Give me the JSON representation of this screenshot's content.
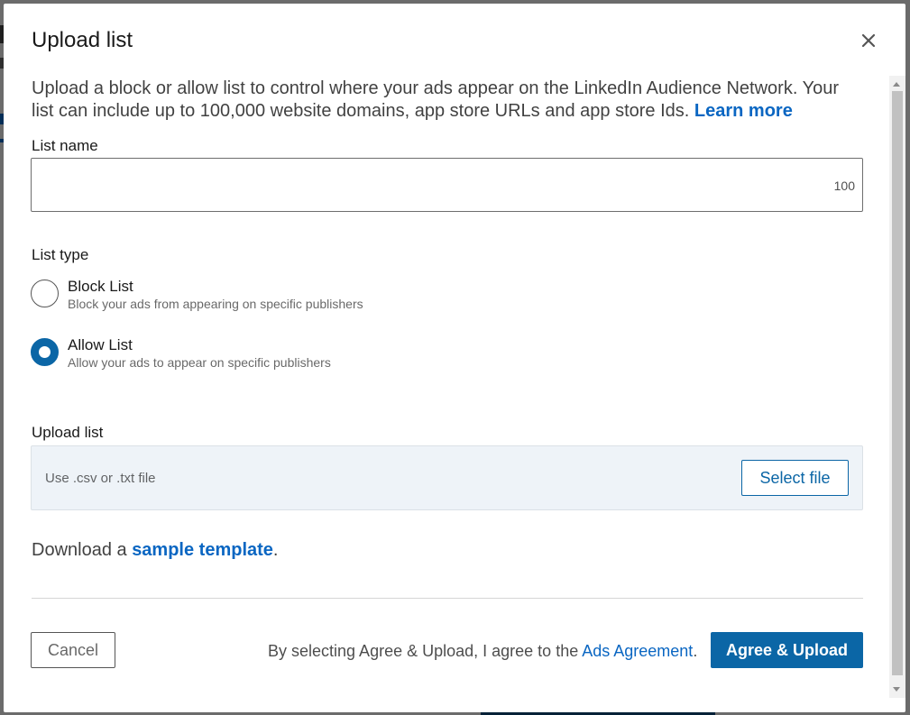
{
  "dialog": {
    "title": "Upload list",
    "close_icon": "close-icon"
  },
  "intro": {
    "text": "Upload a block or allow list to control where your ads appear on the LinkedIn Audience Network. Your list can include up to 100,000 website domains, app store URLs and app store Ids.",
    "learn_more": "Learn more"
  },
  "list_name": {
    "label": "List name",
    "value": "",
    "char_limit": "100"
  },
  "list_type": {
    "label": "List type",
    "options": [
      {
        "title": "Block List",
        "subtitle": "Block your ads from appearing on specific publishers",
        "selected": false
      },
      {
        "title": "Allow List",
        "subtitle": "Allow your ads to appear on specific publishers",
        "selected": true
      }
    ]
  },
  "upload": {
    "label": "Upload list",
    "hint": "Use .csv or .txt file",
    "select_file": "Select file"
  },
  "download": {
    "prefix": "Download a",
    "link": "sample template",
    "suffix": "."
  },
  "footer": {
    "cancel": "Cancel",
    "agree_prefix": "By selecting Agree & Upload, I agree to the",
    "agreement_link": "Ads Agreement",
    "agree_suffix": ".",
    "primary": "Agree & Upload"
  },
  "colors": {
    "accent": "#0b66a6",
    "link": "#0a66c2"
  }
}
